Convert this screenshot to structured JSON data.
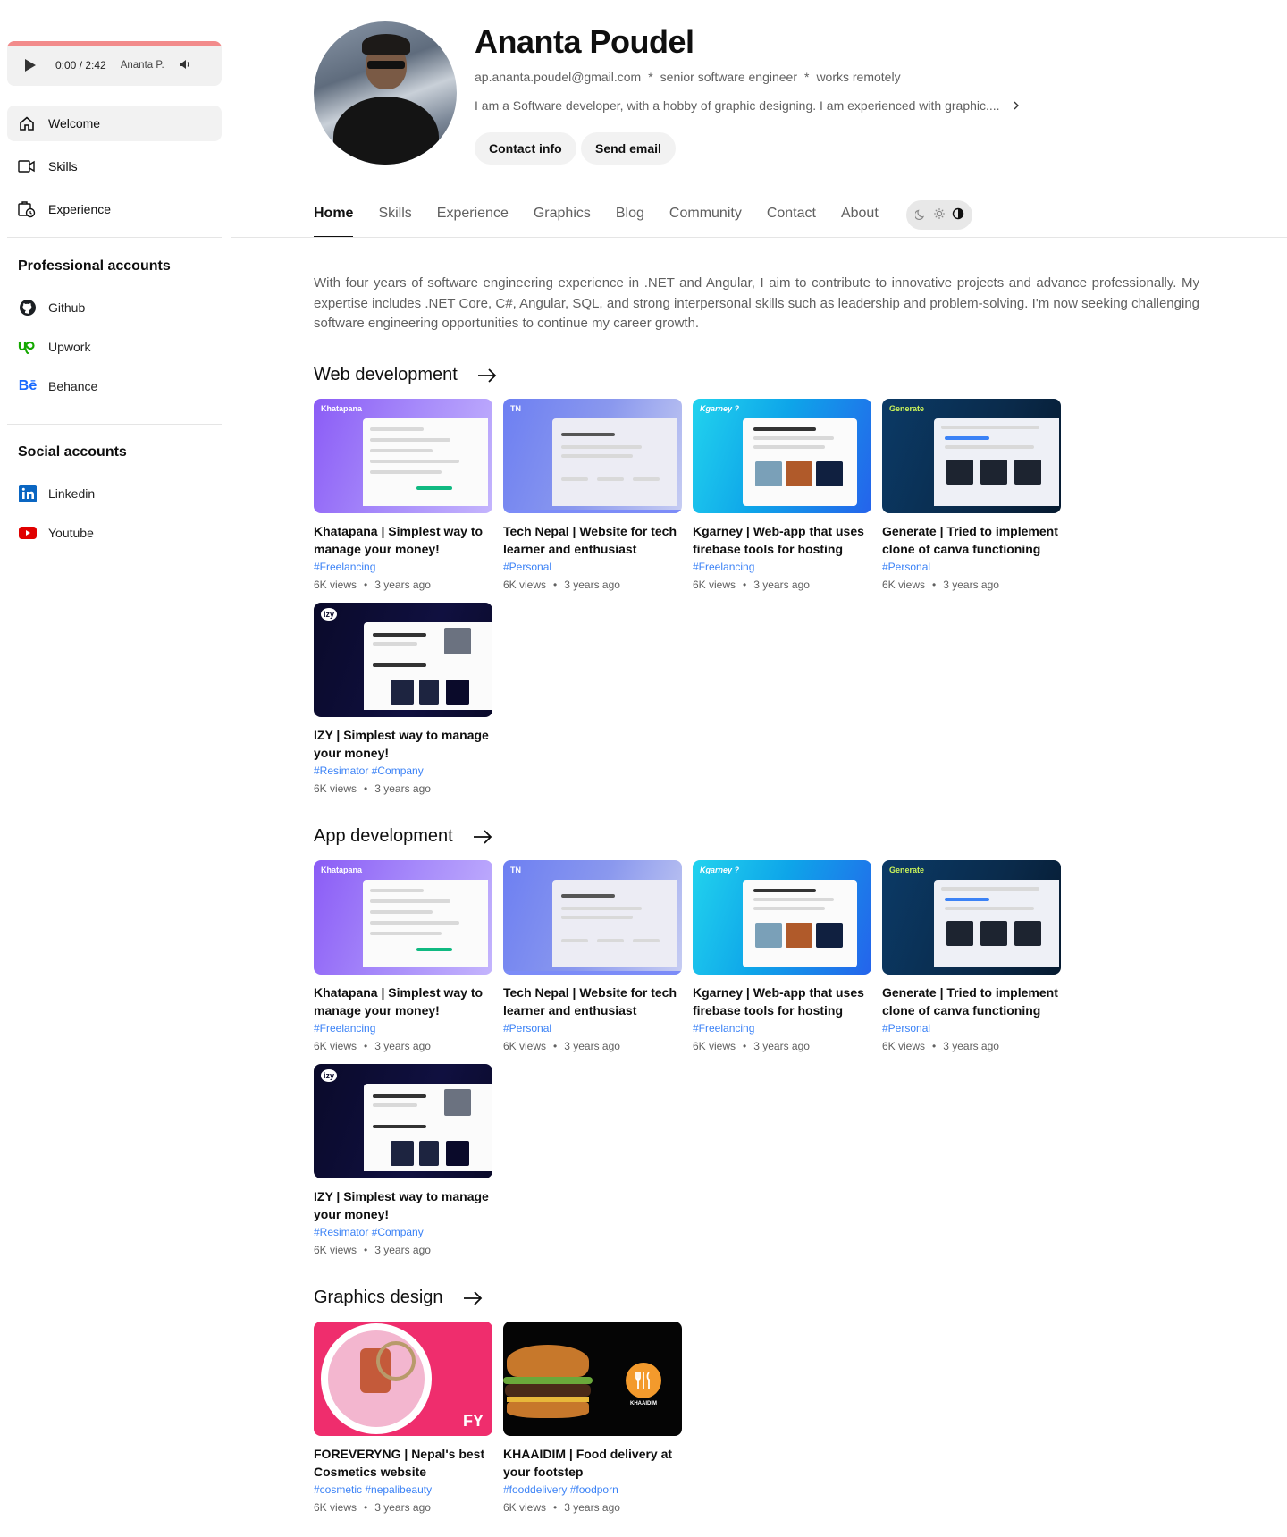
{
  "player": {
    "time": "0:00 / 2:42",
    "name": "Ananta P."
  },
  "nav": [
    {
      "label": "Welcome",
      "icon": "home-icon",
      "active": true
    },
    {
      "label": "Skills",
      "icon": "video-icon",
      "active": false
    },
    {
      "label": "Experience",
      "icon": "clock-icon",
      "active": false
    }
  ],
  "professional": {
    "title": "Professional accounts",
    "items": [
      {
        "label": "Github",
        "icon": "github-icon"
      },
      {
        "label": "Upwork",
        "icon": "upwork-icon"
      },
      {
        "label": "Behance",
        "icon": "behance-icon"
      }
    ]
  },
  "social": {
    "title": "Social accounts",
    "items": [
      {
        "label": "Linkedin",
        "icon": "linkedin-icon"
      },
      {
        "label": "Youtube",
        "icon": "youtube-icon"
      }
    ]
  },
  "profile": {
    "name": "Ananta Poudel",
    "email": "ap.ananta.poudel@gmail.com",
    "role": "senior software engineer",
    "location": "works remotely",
    "separator": "*",
    "bio": "I am a Software developer, with a hobby of graphic designing. I am experienced with graphic....",
    "buttons": {
      "contact": "Contact info",
      "email": "Send email"
    }
  },
  "tabs": [
    "Home",
    "Skills",
    "Experience",
    "Graphics",
    "Blog",
    "Community",
    "Contact",
    "About"
  ],
  "intro": "With four years of software engineering experience in .NET and Angular, I aim to contribute to innovative projects and advance professionally. My expertise includes .NET Core, C#, Angular, SQL, and strong interpersonal skills such as leadership and problem-solving. I'm now seeking challenging software engineering opportunities to continue my career growth.",
  "sections": {
    "web": {
      "title": "Web development",
      "cards": [
        {
          "title": "Khatapana | Simplest way to manage your money!",
          "tags": "#Freelancing",
          "views": "6K views",
          "age": "3 years ago",
          "thumb_label": "Khatapana"
        },
        {
          "title": "Tech Nepal | Website for tech learner and enthusiast",
          "tags": "#Personal",
          "views": "6K views",
          "age": "3 years ago",
          "thumb_label": "TN"
        },
        {
          "title": "Kgarney | Web-app that uses firebase tools for hosting",
          "tags": "#Freelancing",
          "views": "6K views",
          "age": "3 years ago",
          "thumb_label": "Kgarney ?"
        },
        {
          "title": "Generate | Tried to implement clone of canva functioning",
          "tags": "#Personal",
          "views": "6K views",
          "age": "3 years ago",
          "thumb_label": "Generate"
        },
        {
          "title": "IZY | Simplest way to manage your money!",
          "tags": "#Resimator #Company",
          "views": "6K views",
          "age": "3 years ago",
          "thumb_label": "izy"
        }
      ]
    },
    "app": {
      "title": "App development",
      "cards": [
        {
          "title": "Khatapana | Simplest way to manage your money!",
          "tags": "#Freelancing",
          "views": "6K views",
          "age": "3 years ago",
          "thumb_label": "Khatapana"
        },
        {
          "title": "Tech Nepal | Website for tech learner and enthusiast",
          "tags": "#Personal",
          "views": "6K views",
          "age": "3 years ago",
          "thumb_label": "TN"
        },
        {
          "title": "Kgarney | Web-app that uses firebase tools for hosting",
          "tags": "#Freelancing",
          "views": "6K views",
          "age": "3 years ago",
          "thumb_label": "Kgarney ?"
        },
        {
          "title": "Generate | Tried to implement clone of canva functioning",
          "tags": "#Personal",
          "views": "6K views",
          "age": "3 years ago",
          "thumb_label": "Generate"
        },
        {
          "title": "IZY | Simplest way to manage your money!",
          "tags": "#Resimator #Company",
          "views": "6K views",
          "age": "3 years ago",
          "thumb_label": "izy"
        }
      ]
    },
    "graphics": {
      "title": "Graphics design",
      "cards": [
        {
          "title": "FOREVERYNG | Nepal's best Cosmetics website",
          "tags": "#cosmetic #nepalibeauty",
          "views": "6K views",
          "age": "3 years ago",
          "thumb_label": "FY"
        },
        {
          "title": "KHAAIDIM | Food delivery at your footstep",
          "tags": "#fooddelivery #foodporn",
          "views": "6K views",
          "age": "3 years ago",
          "thumb_label": "KHAAIDIM"
        }
      ]
    }
  },
  "colors": {
    "accent_tag": "#3b82f6",
    "progress": "#f28b8b",
    "text_muted": "#606060"
  }
}
